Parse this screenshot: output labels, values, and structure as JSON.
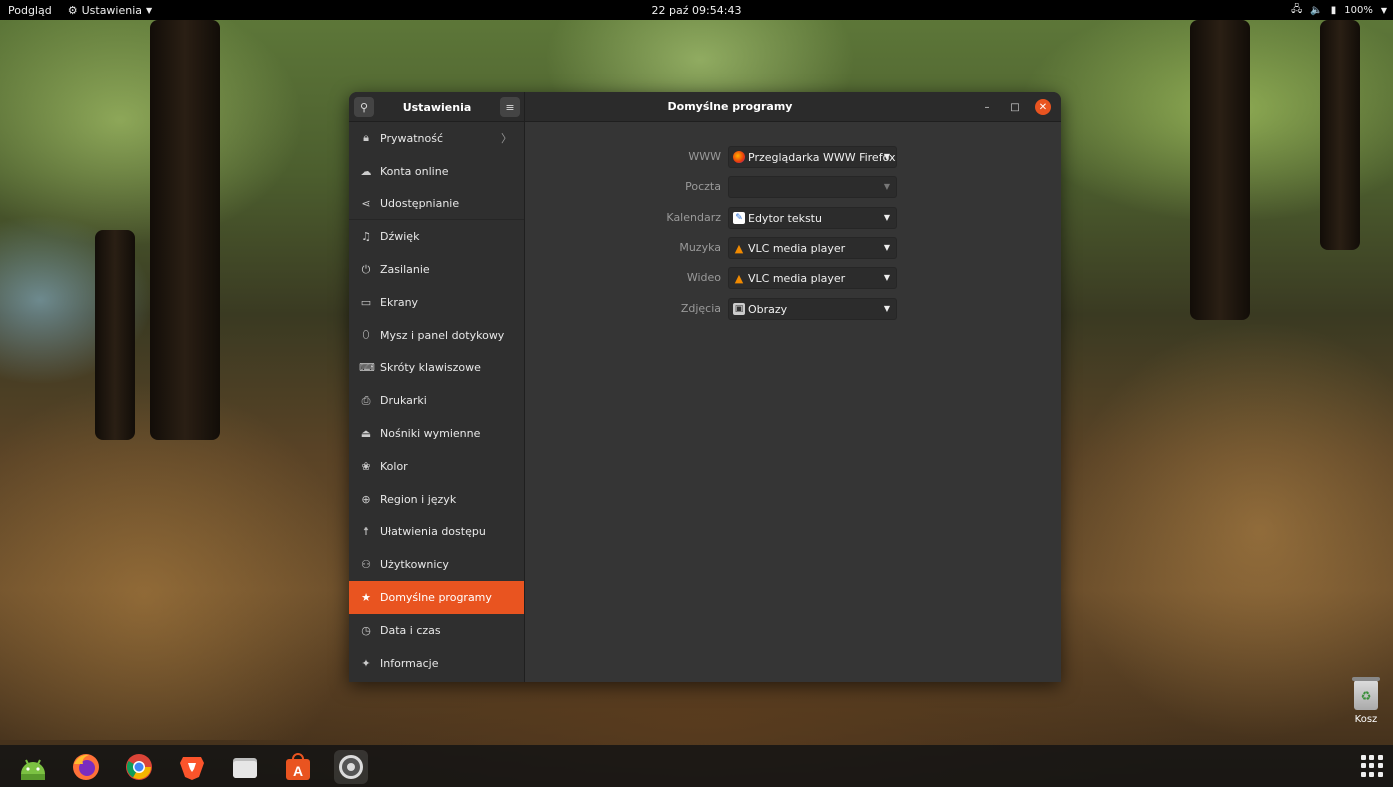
{
  "topbar": {
    "activities": "Podgląd",
    "app_menu": "Ustawienia",
    "clock": "22 paź 09:54:43",
    "battery": "100%"
  },
  "window": {
    "sidebar_title": "Ustawienia",
    "main_title": "Domyślne programy"
  },
  "sidebar": {
    "items": [
      {
        "label": "Prywatność",
        "icon": "lock-icon"
      },
      {
        "label": "Konta online",
        "icon": "cloud-icon"
      },
      {
        "label": "Udostępnianie",
        "icon": "share-icon"
      },
      {
        "label": "Dźwięk",
        "icon": "music-note-icon"
      },
      {
        "label": "Zasilanie",
        "icon": "power-icon"
      },
      {
        "label": "Ekrany",
        "icon": "display-icon"
      },
      {
        "label": "Mysz i panel dotykowy",
        "icon": "mouse-icon"
      },
      {
        "label": "Skróty klawiszowe",
        "icon": "keyboard-icon"
      },
      {
        "label": "Drukarki",
        "icon": "printer-icon"
      },
      {
        "label": "Nośniki wymienne",
        "icon": "removable-media-icon"
      },
      {
        "label": "Kolor",
        "icon": "color-icon"
      },
      {
        "label": "Region i język",
        "icon": "globe-icon"
      },
      {
        "label": "Ułatwienia dostępu",
        "icon": "accessibility-icon"
      },
      {
        "label": "Użytkownicy",
        "icon": "users-icon"
      },
      {
        "label": "Domyślne programy",
        "icon": "star-icon"
      },
      {
        "label": "Data i czas",
        "icon": "clock-icon"
      },
      {
        "label": "Informacje",
        "icon": "info-icon"
      }
    ]
  },
  "defaults": {
    "rows": [
      {
        "label": "WWW",
        "value": "Przeglądarka WWW Firefox",
        "icon": "firefox-icon"
      },
      {
        "label": "Poczta",
        "value": "",
        "icon": ""
      },
      {
        "label": "Kalendarz",
        "value": "Edytor tekstu",
        "icon": "text-editor-icon"
      },
      {
        "label": "Muzyka",
        "value": "VLC media player",
        "icon": "vlc-icon"
      },
      {
        "label": "Wideo",
        "value": "VLC media player",
        "icon": "vlc-icon"
      },
      {
        "label": "Zdjęcia",
        "value": "Obrazy",
        "icon": "image-viewer-icon"
      }
    ]
  },
  "desktop": {
    "trash_label": "Kosz"
  },
  "dock": {
    "apps": [
      "android-studio-icon",
      "firefox-icon",
      "chrome-icon",
      "brave-icon",
      "files-icon",
      "software-center-icon",
      "settings-icon"
    ]
  },
  "colors": {
    "accent": "#e95420",
    "window_bg": "#353535",
    "sidebar_bg": "#2f2f2f"
  }
}
